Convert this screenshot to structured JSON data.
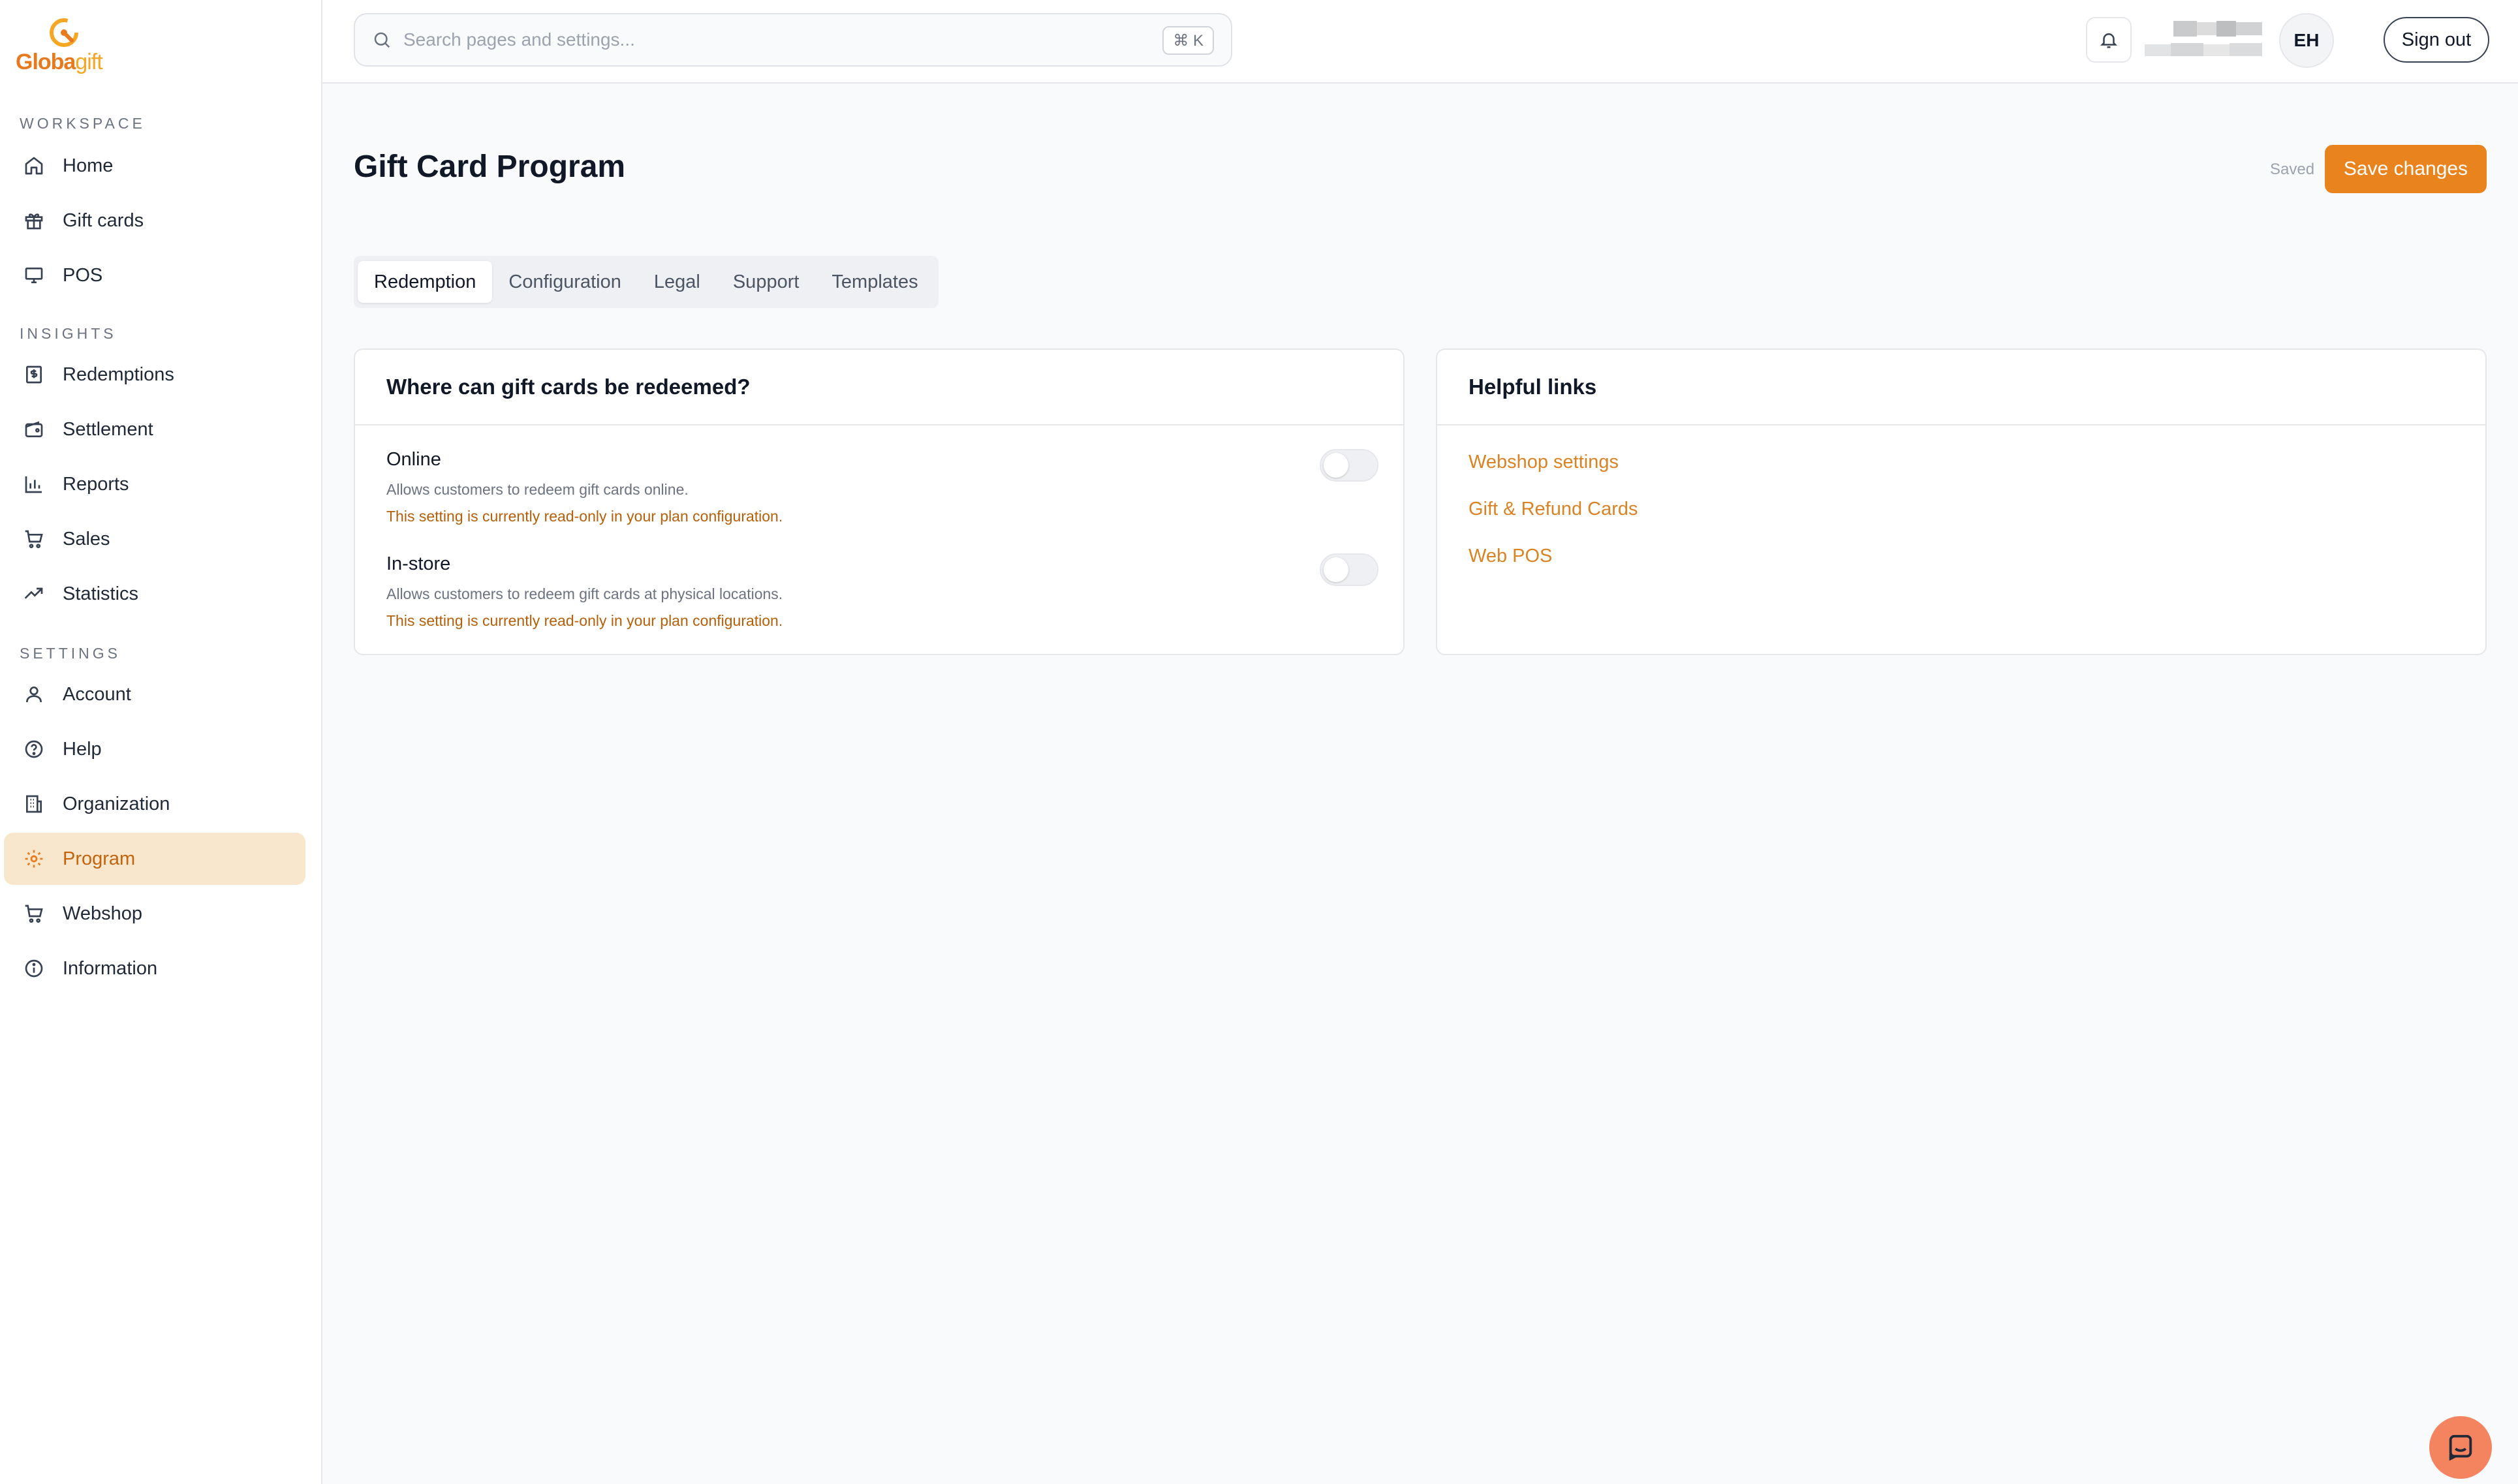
{
  "brand": {
    "name_part1": "Globa",
    "name_part2": "gift",
    "accent": "#e8831e",
    "active_bg": "#f8e7cd"
  },
  "sidebar": {
    "sections": [
      {
        "title": "WORKSPACE",
        "items": [
          {
            "label": "Home",
            "icon": "home-icon"
          },
          {
            "label": "Gift cards",
            "icon": "gift-icon"
          },
          {
            "label": "POS",
            "icon": "monitor-icon"
          }
        ]
      },
      {
        "title": "INSIGHTS",
        "items": [
          {
            "label": "Redemptions",
            "icon": "receipt-dollar-icon"
          },
          {
            "label": "Settlement",
            "icon": "wallet-icon"
          },
          {
            "label": "Reports",
            "icon": "bar-chart-icon"
          },
          {
            "label": "Sales",
            "icon": "cart-icon"
          },
          {
            "label": "Statistics",
            "icon": "trending-up-icon"
          }
        ]
      },
      {
        "title": "SETTINGS",
        "items": [
          {
            "label": "Account",
            "icon": "user-icon"
          },
          {
            "label": "Help",
            "icon": "help-circle-icon"
          },
          {
            "label": "Organization",
            "icon": "building-icon"
          },
          {
            "label": "Program",
            "icon": "gear-icon",
            "active": true
          },
          {
            "label": "Webshop",
            "icon": "cart-icon"
          },
          {
            "label": "Information",
            "icon": "info-icon"
          }
        ]
      }
    ]
  },
  "topbar": {
    "search_placeholder": "Search pages and settings...",
    "search_shortcut": "⌘ K",
    "avatar_initials": "EH",
    "sign_out_label": "Sign out"
  },
  "page": {
    "title": "Gift Card Program",
    "saved_label": "Saved",
    "save_label": "Save changes",
    "tabs": [
      "Redemption",
      "Configuration",
      "Legal",
      "Support",
      "Templates"
    ],
    "active_tab": "Redemption"
  },
  "redemption_card": {
    "title": "Where can gift cards be redeemed?",
    "settings": [
      {
        "name": "Online",
        "description": "Allows customers to redeem gift cards online.",
        "warning": "This setting is currently read-only in your plan configuration.",
        "enabled": false
      },
      {
        "name": "In-store",
        "description": "Allows customers to redeem gift cards at physical locations.",
        "warning": "This setting is currently read-only in your plan configuration.",
        "enabled": false
      }
    ]
  },
  "links_card": {
    "title": "Helpful links",
    "links": [
      "Webshop settings",
      "Gift & Refund Cards",
      "Web POS"
    ]
  }
}
